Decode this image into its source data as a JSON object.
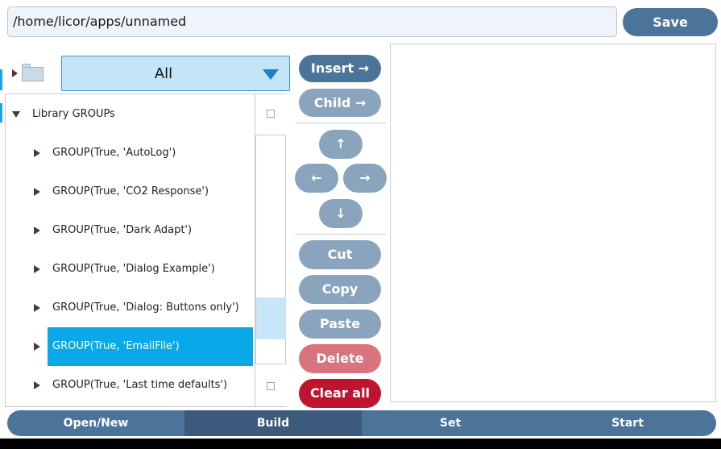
{
  "header": {
    "path": "/home/licor/apps/unnamed",
    "save_label": "Save"
  },
  "filter": {
    "selected": "All"
  },
  "tree": {
    "root_label": "Library GROUPs",
    "items": [
      "GROUP(True, 'AutoLog')",
      "GROUP(True, 'CO2 Response')",
      "GROUP(True, 'Dark Adapt')",
      "GROUP(True, 'Dialog Example')",
      "GROUP(True, 'Dialog: Buttons only')",
      "GROUP(True, 'EmailFile')",
      "GROUP(True, 'Last time defaults')"
    ],
    "selected_index": 5
  },
  "actions": {
    "insert": "Insert →",
    "child": "Child →",
    "up": "↑",
    "left": "←",
    "right": "→",
    "down": "↓",
    "cut": "Cut",
    "copy": "Copy",
    "paste": "Paste",
    "delete": "Delete",
    "clear_all": "Clear all"
  },
  "nav": {
    "tabs": [
      "Open/New",
      "Build",
      "Set",
      "Start"
    ],
    "active": "Build"
  },
  "colors": {
    "primary_button": "#4c7399",
    "disabled_button": "#8aa4bd",
    "selection": "#09a8e8",
    "delete": "#d9737e",
    "clear_all": "#bf1330"
  }
}
